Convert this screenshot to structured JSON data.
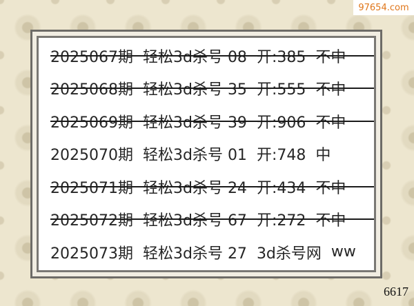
{
  "watermark": "97654.com",
  "corner_number": "6617",
  "rows": [
    {
      "issue": "2025067期",
      "kill": "轻松3d杀号 08",
      "open": "开:385",
      "result": "不中",
      "strike": true
    },
    {
      "issue": "2025068期",
      "kill": "轻松3d杀号 35",
      "open": "开:555",
      "result": "不中",
      "strike": true
    },
    {
      "issue": "2025069期",
      "kill": "轻松3d杀号 39",
      "open": "开:906",
      "result": "不中",
      "strike": true
    },
    {
      "issue": "2025070期",
      "kill": "轻松3d杀号 01",
      "open": "开:748",
      "result": "中",
      "strike": false
    },
    {
      "issue": "2025071期",
      "kill": "轻松3d杀号 24",
      "open": "开:434",
      "result": "不中",
      "strike": true
    },
    {
      "issue": "2025072期",
      "kill": "轻松3d杀号 67",
      "open": "开:272",
      "result": "不中",
      "strike": true
    },
    {
      "issue": "2025073期",
      "kill": "轻松3d杀号 27",
      "open": "3d杀号网",
      "result": "ww",
      "strike": false
    }
  ]
}
